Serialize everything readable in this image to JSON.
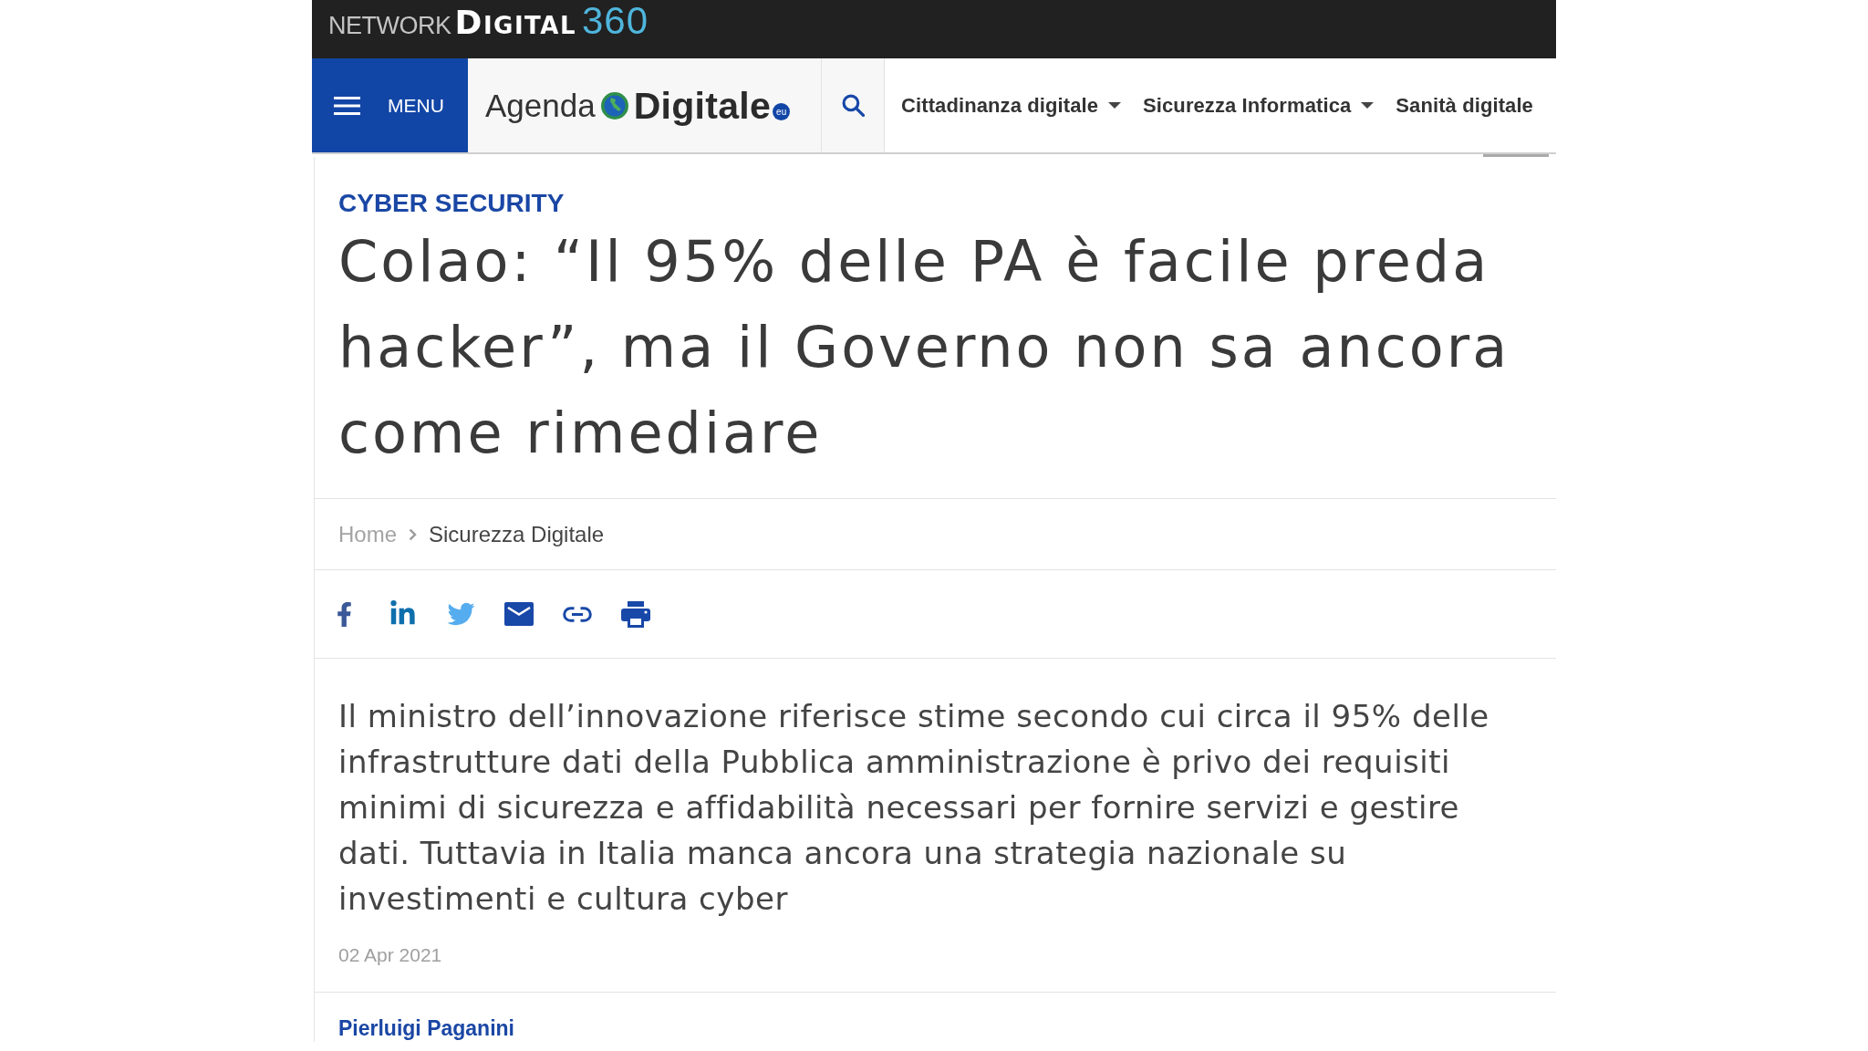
{
  "network_bar": {
    "logo": {
      "prefix": "NETWORK",
      "name": "DIGITAL",
      "suffix": "360"
    }
  },
  "nav": {
    "menu_button": {
      "label": "MENU"
    },
    "site_logo": {
      "word_1": "Agenda",
      "word_2": "Digitale",
      "badge": "eu"
    },
    "items": [
      {
        "label": "Cittadinanza digitale",
        "has_dropdown": true
      },
      {
        "label": "Sicurezza Informatica",
        "has_dropdown": true
      },
      {
        "label": "Sanità digitale",
        "has_dropdown": false
      }
    ]
  },
  "article": {
    "category": "CYBER SECURITY",
    "title": "Colao: “Il 95% delle PA è facile preda hacker”, ma il Governo non sa ancora come rimediare",
    "breadcrumb": [
      {
        "label": "Home",
        "current": false
      },
      {
        "label": "Sicurezza Digitale",
        "current": true
      }
    ],
    "summary": "Il ministro dell’innovazione riferisce stime secondo cui circa il 95% delle infrastrutture dati della Pubblica amministrazione è privo dei requisiti minimi di sicurezza e affidabilità necessari per fornire servizi e gestire dati. Tuttavia in Italia manca ancora una strategia nazionale su investimenti e cultura cyber",
    "date": "02 Apr 2021",
    "author": "Pierluigi Paganini"
  }
}
